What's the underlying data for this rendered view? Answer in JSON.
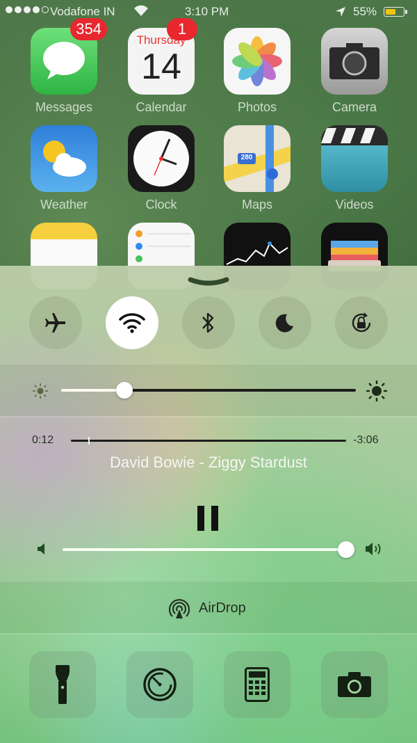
{
  "status_bar": {
    "carrier": "Vodafone IN",
    "time": "3:10 PM",
    "battery_percent": "55%",
    "battery_level": 0.55,
    "signal_bars": 4,
    "signal_total": 5
  },
  "home_screen": {
    "apps": [
      {
        "label": "Messages",
        "badge": "354"
      },
      {
        "label": "Calendar",
        "badge": "1",
        "weekday": "Thursday",
        "day": "14"
      },
      {
        "label": "Photos"
      },
      {
        "label": "Camera"
      },
      {
        "label": "Weather"
      },
      {
        "label": "Clock"
      },
      {
        "label": "Maps",
        "route_sign": "280"
      },
      {
        "label": "Videos"
      }
    ]
  },
  "control_center": {
    "toggles": [
      {
        "name": "airplane-mode",
        "icon": "airplane-icon",
        "active": false
      },
      {
        "name": "wifi",
        "icon": "wifi-icon",
        "active": true
      },
      {
        "name": "bluetooth",
        "icon": "bluetooth-icon",
        "active": false
      },
      {
        "name": "do-not-disturb",
        "icon": "moon-icon",
        "active": false
      },
      {
        "name": "rotation-lock",
        "icon": "rotation-lock-icon",
        "active": false
      }
    ],
    "brightness_level": 0.2,
    "music": {
      "elapsed": "0:12",
      "remaining": "-3:06",
      "track": "David Bowie - Ziggy Stardust",
      "progress": 0.06
    },
    "volume_level": 1.0,
    "airdrop_label": "AirDrop",
    "shortcuts": [
      {
        "name": "flashlight",
        "icon": "flashlight-icon"
      },
      {
        "name": "timer",
        "icon": "timer-icon"
      },
      {
        "name": "calculator",
        "icon": "calculator-icon"
      },
      {
        "name": "camera",
        "icon": "camera-icon"
      }
    ],
    "accent_colors": {
      "active_toggle_bg": "#ffffff",
      "track_dark": "#1d1d1b",
      "track_light": "#ffffff"
    }
  }
}
